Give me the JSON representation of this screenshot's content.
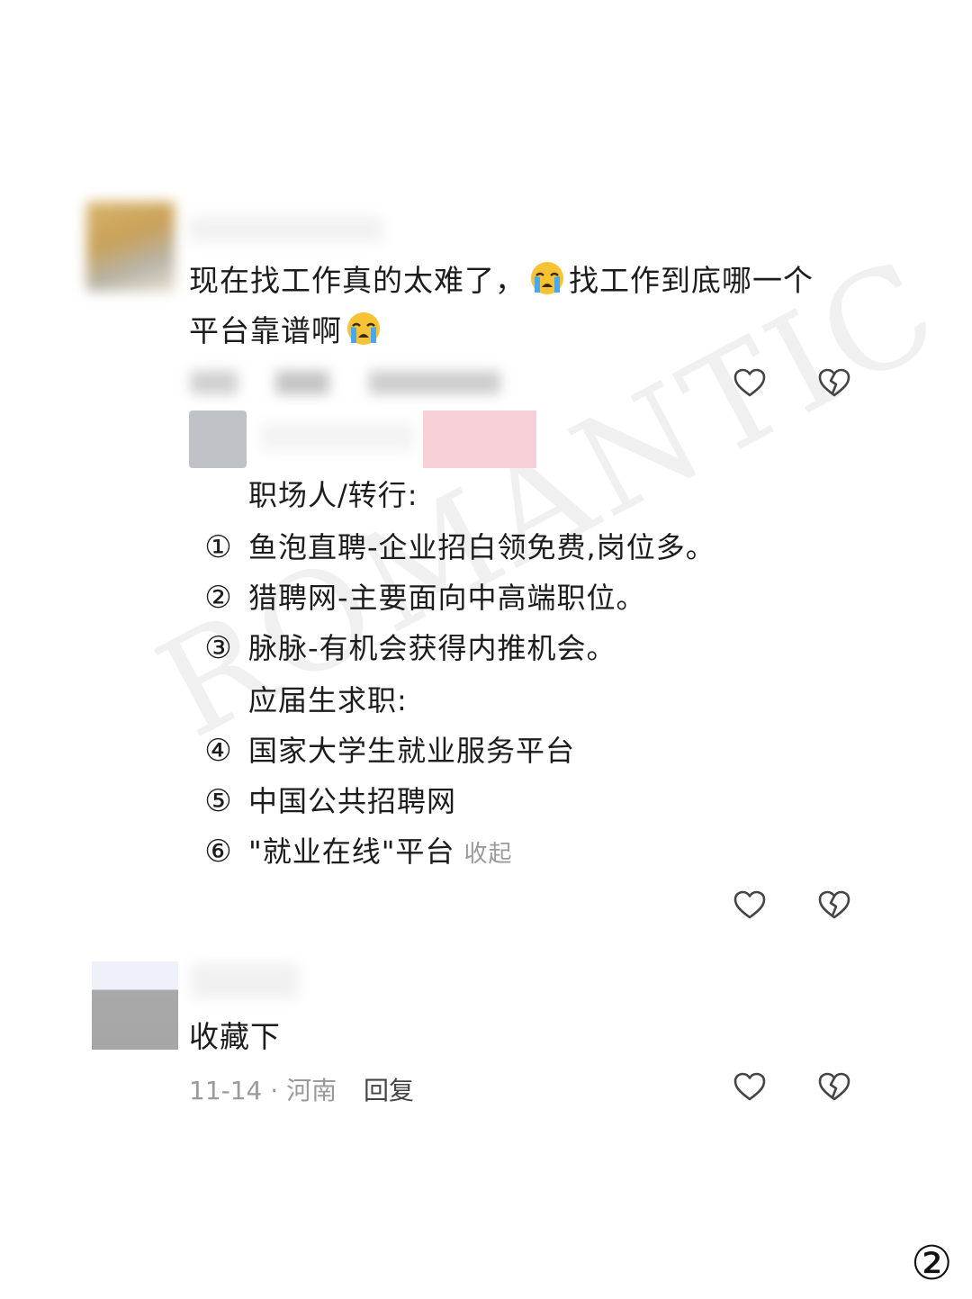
{
  "watermark": "ROMANTIC",
  "comment1": {
    "text_part1": "现在找工作真的太难了，",
    "text_part2": "找工作到底哪一个",
    "text_line2": "平台靠谱啊",
    "emoji": "loudly-crying-face"
  },
  "reply": {
    "heading1": "职场人/转行:",
    "items_a": [
      {
        "num": "①",
        "text": "鱼泡直聘-企业招白领免费,岗位多。"
      },
      {
        "num": "②",
        "text": "猎聘网-主要面向中高端职位。"
      },
      {
        "num": "③",
        "text": "脉脉-有机会获得内推机会。"
      }
    ],
    "heading2": "应届生求职:",
    "items_b": [
      {
        "num": "④",
        "text": "国家大学生就业服务平台"
      },
      {
        "num": "⑤",
        "text": "中国公共招聘网"
      },
      {
        "num": "⑥",
        "text": "\"就业在线\"平台"
      }
    ],
    "collapse_label": "收起"
  },
  "comment2": {
    "text": "收藏下",
    "meta": "11-14 · 河南",
    "reply_label": "回复"
  },
  "page_number": "②",
  "colors": {
    "icon": "#444444",
    "meta": "#9a9a9a"
  }
}
